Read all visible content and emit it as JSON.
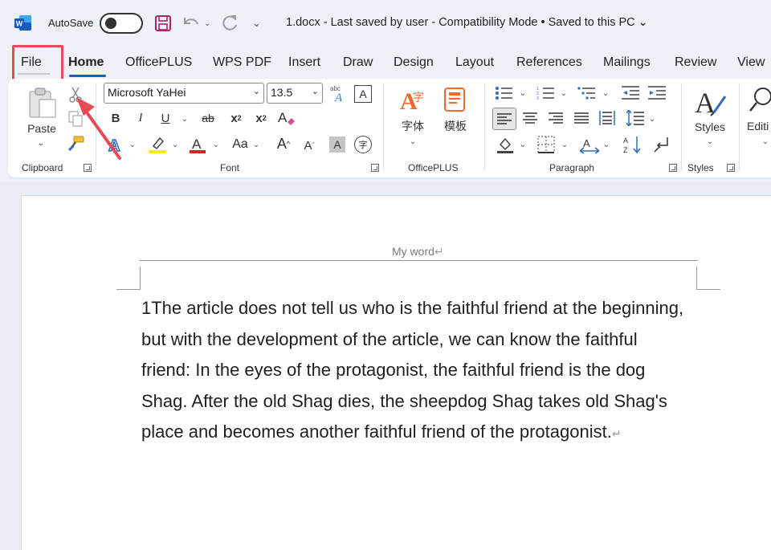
{
  "titlebar": {
    "autosave_label": "AutoSave",
    "doc_title": "1.docx  -  Last saved by user  -  Compatibility Mode  •  Saved to this PC ⌄"
  },
  "tabs": [
    {
      "label": "File"
    },
    {
      "label": "Home"
    },
    {
      "label": "OfficePLUS"
    },
    {
      "label": "WPS PDF"
    },
    {
      "label": "Insert"
    },
    {
      "label": "Draw"
    },
    {
      "label": "Design"
    },
    {
      "label": "Layout"
    },
    {
      "label": "References"
    },
    {
      "label": "Mailings"
    },
    {
      "label": "Review"
    },
    {
      "label": "View"
    }
  ],
  "ribbon": {
    "clipboard": {
      "paste_label": "Paste",
      "group_label": "Clipboard"
    },
    "font": {
      "font_name": "Microsoft YaHei",
      "font_size": "13.5",
      "group_label": "Font",
      "bold": "B",
      "italic": "I",
      "underline": "U",
      "strike": "ab",
      "subscript": "x",
      "superscript": "x",
      "case": "Aa",
      "grow": "A",
      "shrink": "A",
      "shade": "A",
      "enclose": "字"
    },
    "officeplus": {
      "font_label": "字体",
      "template_label": "模板",
      "group_label": "OfficePLUS"
    },
    "paragraph": {
      "group_label": "Paragraph"
    },
    "styles": {
      "label": "Styles",
      "group_label": "Styles"
    },
    "editing": {
      "label": "Editi"
    }
  },
  "document": {
    "header": "My word",
    "body": "1The article does not tell us who is the faithful friend at the beginning, but with the development of the article, we can know the faithful friend: In the eyes of the protagonist, the faithful friend is the dog Shag. After the old Shag dies, the sheepdog Shag takes old Shag's place and becomes another faithful friend of the protagonist."
  },
  "colors": {
    "highlight_box": "#e64a54",
    "accent": "#1e5bb8",
    "word_blue": "#185abd"
  }
}
